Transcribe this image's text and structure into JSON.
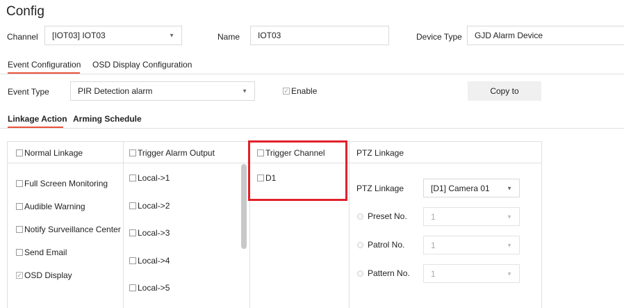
{
  "title": "Config",
  "channel": {
    "label": "Channel",
    "value": "[IOT03] IOT03"
  },
  "name": {
    "label": "Name",
    "value": "IOT03"
  },
  "device_type": {
    "label": "Device Type",
    "value": "GJD Alarm Device"
  },
  "tabs": [
    {
      "label": "Event Configuration",
      "active": true
    },
    {
      "label": "OSD Display Configuration",
      "active": false
    }
  ],
  "event_type": {
    "label": "Event Type",
    "value": "PIR Detection alarm"
  },
  "enable": {
    "label": "Enable",
    "checked": true
  },
  "copy_button": "Copy to",
  "subtabs": [
    {
      "label": "Linkage Action",
      "active": true
    },
    {
      "label": "Arming Schedule",
      "active": false
    }
  ],
  "linkage": {
    "normal_header": "Normal Linkage",
    "normal_items": [
      {
        "label": "Full Screen Monitoring",
        "checked": false
      },
      {
        "label": "Audible Warning",
        "checked": false
      },
      {
        "label": "Notify Surveillance Center",
        "checked": false
      },
      {
        "label": "Send Email",
        "checked": false
      },
      {
        "label": "OSD Display",
        "checked": true
      }
    ],
    "alarm_header": "Trigger Alarm Output",
    "alarm_items": [
      "Local->1",
      "Local->2",
      "Local->3",
      "Local->4",
      "Local->5"
    ],
    "channel_header": "Trigger Channel",
    "channel_items": [
      "D1"
    ],
    "ptz_header": "PTZ Linkage",
    "ptz_linkage": {
      "label": "PTZ Linkage",
      "value": "[D1] Camera 01"
    },
    "preset": {
      "label": "Preset No.",
      "value": "1"
    },
    "patrol": {
      "label": "Patrol No.",
      "value": "1"
    },
    "pattern": {
      "label": "Pattern No.",
      "value": "1"
    }
  },
  "colors": {
    "accent": "#e8503a",
    "highlight_box": "#e0202a"
  }
}
